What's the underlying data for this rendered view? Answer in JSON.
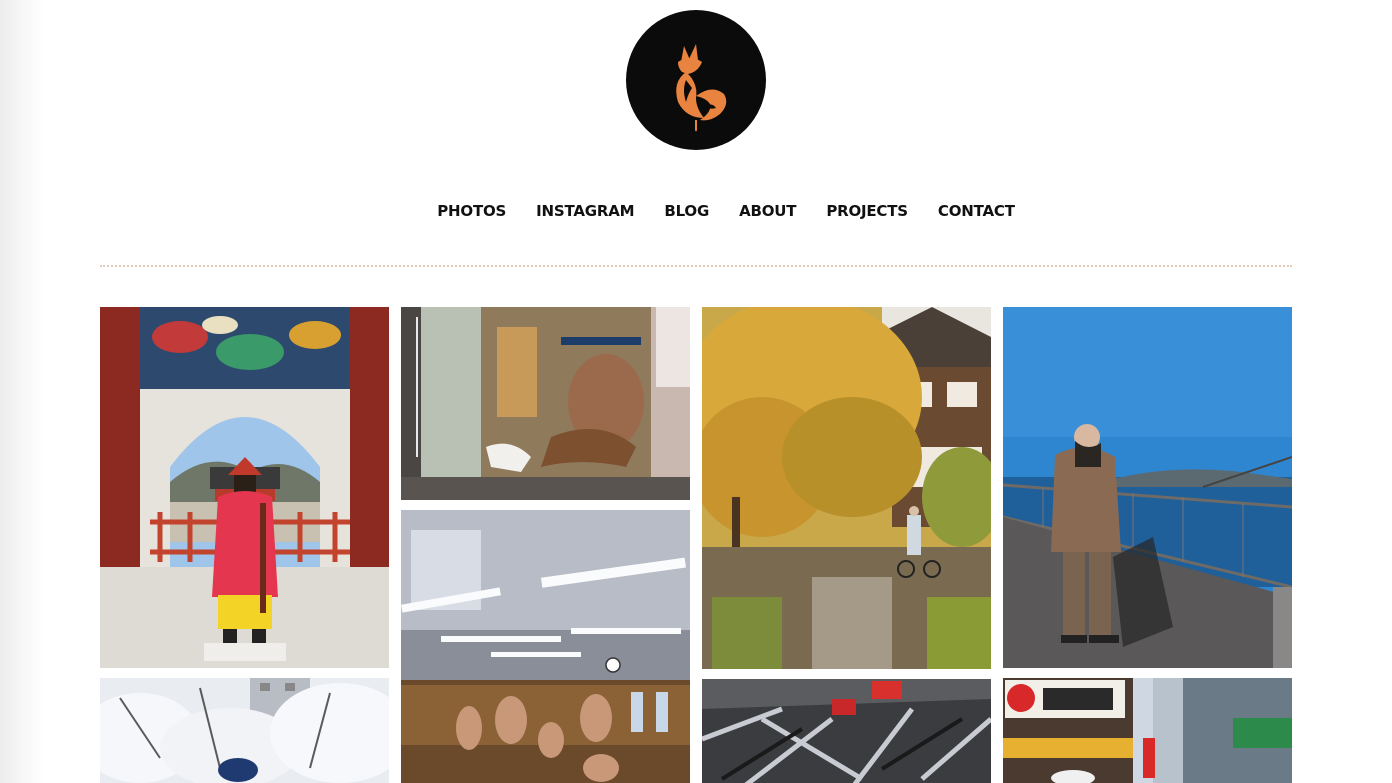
{
  "site": {
    "logo_icon": "fox-icon",
    "accent_color": "#e8843f",
    "logo_background": "#0b0b0b"
  },
  "nav": {
    "items": [
      {
        "label": "PHOTOS"
      },
      {
        "label": "INSTAGRAM"
      },
      {
        "label": "BLOG"
      },
      {
        "label": "ABOUT"
      },
      {
        "label": "PROJECTS"
      },
      {
        "label": "CONTACT"
      }
    ]
  },
  "gallery": {
    "photos": [
      {
        "subject": "royal-guard-at-palace-gate"
      },
      {
        "subject": "sumo-wrestler-behind-glass"
      },
      {
        "subject": "autumn-temple-garden-with-cyclist"
      },
      {
        "subject": "old-man-fishing-on-pier"
      },
      {
        "subject": "cherry-blossoms"
      },
      {
        "subject": "sumo-training-hall"
      },
      {
        "subject": "crowded-street-reflection"
      },
      {
        "subject": "neon-shopping-street"
      }
    ]
  }
}
